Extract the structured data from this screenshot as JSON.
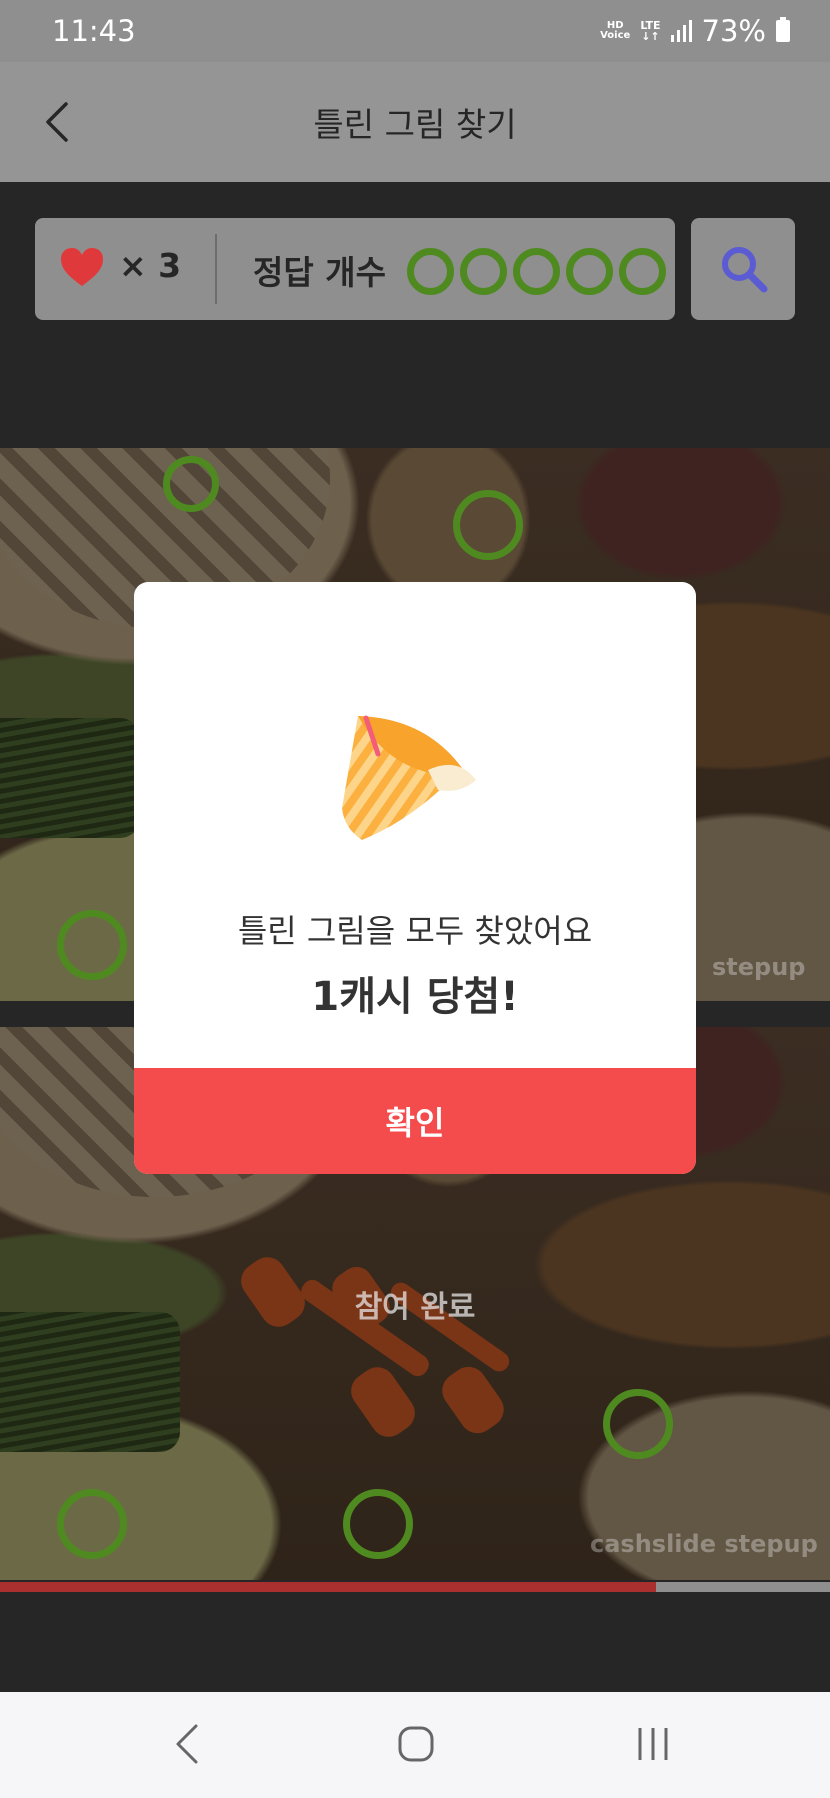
{
  "status_bar": {
    "time": "11:43",
    "hd_line1": "HD",
    "hd_line2": "Voice",
    "lte_label": "LTE",
    "battery": "73%"
  },
  "header": {
    "title": "틀린 그림 찾기",
    "back_icon": "chevron-left-icon"
  },
  "score_panel": {
    "lives_text": "× 3",
    "answer_label": "정답 개수",
    "found_count": 5,
    "total_count": 5,
    "heart_color": "#e0393c",
    "ring_color": "#4f8a21",
    "search_icon": "magnifier-icon",
    "search_icon_color": "#5b5bd3"
  },
  "images": {
    "top_watermark": "stepup",
    "bottom_watermark": "cashslide stepup",
    "overlay_text": "참여 완료"
  },
  "progress": {
    "value": 0.79,
    "fill_color": "#aa2f2f"
  },
  "modal": {
    "icon": "party-popper-icon",
    "message": "틀린 그림을 모두 찾았어요",
    "reward": "1캐시 당첨!",
    "confirm_label": "확인",
    "button_color": "#f44b4d"
  },
  "nav_bar": {
    "back_icon": "nav-back-icon",
    "home_icon": "nav-home-icon",
    "recents_icon": "nav-recents-icon"
  }
}
